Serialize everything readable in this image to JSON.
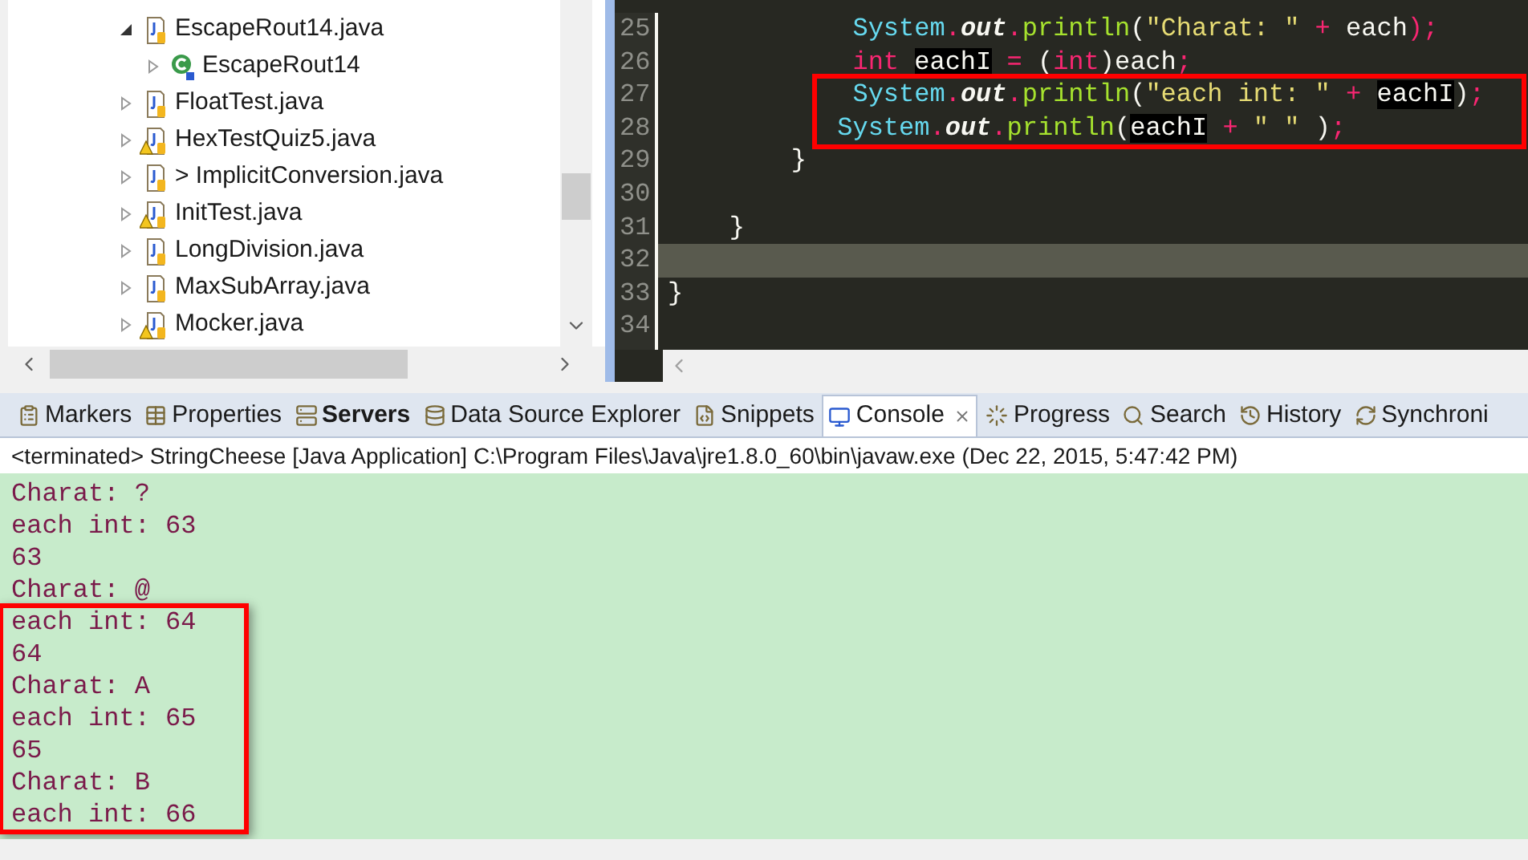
{
  "tree": {
    "items": [
      {
        "label": "EscapeRout14.java",
        "kind": "java-file",
        "warning": false,
        "expanded": true,
        "children": [
          {
            "label": "EscapeRout14",
            "kind": "class",
            "warning": false,
            "expanded": false
          }
        ]
      },
      {
        "label": "FloatTest.java",
        "kind": "java-file",
        "warning": false,
        "expanded": false
      },
      {
        "label": "HexTestQuiz5.java",
        "kind": "java-file",
        "warning": true,
        "expanded": false
      },
      {
        "label": "> ImplicitConversion.java",
        "kind": "java-file",
        "warning": false,
        "expanded": false
      },
      {
        "label": "InitTest.java",
        "kind": "java-file",
        "warning": true,
        "expanded": false
      },
      {
        "label": "LongDivision.java",
        "kind": "java-file",
        "warning": false,
        "expanded": false
      },
      {
        "label": "MaxSubArray.java",
        "kind": "java-file",
        "warning": false,
        "expanded": false
      },
      {
        "label": "Mocker.java",
        "kind": "java-file",
        "warning": true,
        "expanded": false
      }
    ]
  },
  "editor": {
    "lines": [
      {
        "number": "25",
        "current": false,
        "boxed": false,
        "tokens": [
          {
            "text": "            System",
            "kind": "type"
          },
          {
            "text": ".",
            "kind": "op"
          },
          {
            "text": "out",
            "kind": "field"
          },
          {
            "text": ".",
            "kind": "op"
          },
          {
            "text": "println",
            "kind": "method"
          },
          {
            "text": "(",
            "kind": "plain"
          },
          {
            "text": "\"Charat: \"",
            "kind": "string"
          },
          {
            "text": " + ",
            "kind": "op"
          },
          {
            "text": "each",
            "kind": "plain"
          },
          {
            "text": ");",
            "kind": "op"
          }
        ]
      },
      {
        "number": "26",
        "current": false,
        "boxed": false,
        "tokens": [
          {
            "text": "            int ",
            "kind": "keyword"
          },
          {
            "text": "eachI",
            "kind": "occurrence"
          },
          {
            "text": " = ",
            "kind": "op"
          },
          {
            "text": "(",
            "kind": "plain"
          },
          {
            "text": "int",
            "kind": "keyword"
          },
          {
            "text": ")each",
            "kind": "plain"
          },
          {
            "text": ";",
            "kind": "op"
          }
        ]
      },
      {
        "number": "27",
        "current": false,
        "boxed": true,
        "tokens": [
          {
            "text": "            System",
            "kind": "type"
          },
          {
            "text": ".",
            "kind": "op"
          },
          {
            "text": "out",
            "kind": "field"
          },
          {
            "text": ".",
            "kind": "op"
          },
          {
            "text": "println",
            "kind": "method"
          },
          {
            "text": "(",
            "kind": "plain"
          },
          {
            "text": "\"each int: \"",
            "kind": "string"
          },
          {
            "text": " + ",
            "kind": "op"
          },
          {
            "text": "eachI",
            "kind": "occurrence"
          },
          {
            "text": ")",
            "kind": "plain"
          },
          {
            "text": ";",
            "kind": "op"
          }
        ]
      },
      {
        "number": "28",
        "current": false,
        "boxed": true,
        "tokens": [
          {
            "text": "           System",
            "kind": "type"
          },
          {
            "text": ".",
            "kind": "op"
          },
          {
            "text": "out",
            "kind": "field"
          },
          {
            "text": ".",
            "kind": "op"
          },
          {
            "text": "println",
            "kind": "method"
          },
          {
            "text": "(",
            "kind": "plain"
          },
          {
            "text": "eachI",
            "kind": "occurrence"
          },
          {
            "text": " + ",
            "kind": "op"
          },
          {
            "text": "\" \"",
            "kind": "string"
          },
          {
            "text": " )",
            "kind": "plain"
          },
          {
            "text": ";",
            "kind": "op"
          }
        ]
      },
      {
        "number": "29",
        "current": false,
        "boxed": false,
        "tokens": [
          {
            "text": "        }",
            "kind": "plain"
          }
        ]
      },
      {
        "number": "30",
        "current": false,
        "boxed": false
      },
      {
        "number": "31",
        "current": false,
        "boxed": false,
        "tokens": [
          {
            "text": "    }",
            "kind": "plain"
          }
        ]
      },
      {
        "number": "32",
        "current": true,
        "boxed": false
      },
      {
        "number": "33",
        "current": false,
        "boxed": false,
        "tokens": [
          {
            "text": "}",
            "kind": "plain"
          }
        ]
      },
      {
        "number": "34",
        "current": false,
        "boxed": false
      }
    ]
  },
  "tabs": [
    {
      "label": "Markers",
      "selected": false,
      "changed": false
    },
    {
      "label": "Properties",
      "selected": false,
      "changed": false
    },
    {
      "label": "Servers",
      "selected": false,
      "changed": true
    },
    {
      "label": "Data Source Explorer",
      "selected": false,
      "changed": false
    },
    {
      "label": "Snippets",
      "selected": false,
      "changed": false
    },
    {
      "label": "Console",
      "selected": true,
      "changed": false
    },
    {
      "label": "Progress",
      "selected": false,
      "changed": false
    },
    {
      "label": "Search",
      "selected": false,
      "changed": false
    },
    {
      "label": "History",
      "selected": false,
      "changed": false
    },
    {
      "label": "Synchroni",
      "selected": false,
      "changed": false
    }
  ],
  "console": {
    "status": "<terminated> StringCheese [Java Application] C:\\Program Files\\Java\\jre1.8.0_60\\bin\\javaw.exe (Dec 22, 2015, 5:47:42 PM)",
    "lines": [
      {
        "text": "Charat: ?",
        "boxed": false
      },
      {
        "text": "each int: 63",
        "boxed": false
      },
      {
        "text": "63",
        "boxed": false
      },
      {
        "text": "Charat: @",
        "boxed": false
      },
      {
        "text": "each int: 64",
        "boxed": true
      },
      {
        "text": "64",
        "boxed": true
      },
      {
        "text": "Charat: A",
        "boxed": true
      },
      {
        "text": "each int: 65",
        "boxed": true
      },
      {
        "text": "65",
        "boxed": true
      },
      {
        "text": "Charat: B",
        "boxed": true
      },
      {
        "text": "each int: 66",
        "boxed": true
      }
    ]
  }
}
